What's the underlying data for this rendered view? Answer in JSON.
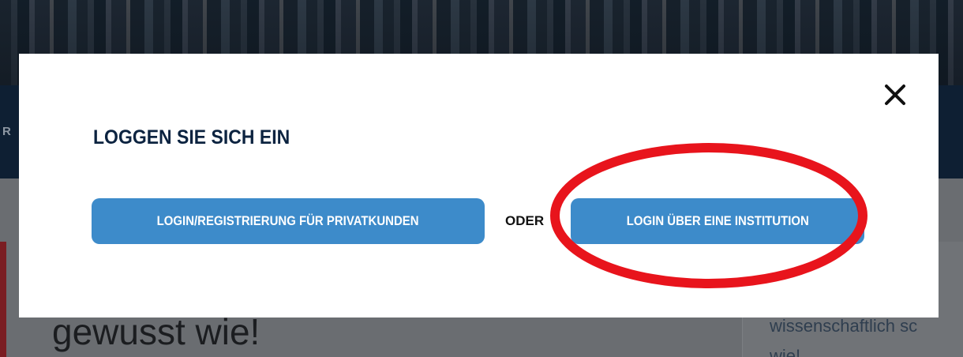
{
  "background": {
    "nav_fragment": "R",
    "headline": "gewusst wie!",
    "side_text_line1": "wissenschaftlich sc",
    "side_text_line2": "wie!"
  },
  "modal": {
    "title": "LOGGEN SIE SICH EIN",
    "close_icon": "close-icon",
    "private_button_label": "LOGIN/REGISTRIERUNG FÜR PRIVATKUNDEN",
    "or_label": "ODER",
    "institution_button_label": "LOGIN ÜBER EINE INSTITUTION"
  },
  "colors": {
    "button_blue": "#3d8bca",
    "title_navy": "#0c2340",
    "annotation_red": "#e8141c"
  }
}
